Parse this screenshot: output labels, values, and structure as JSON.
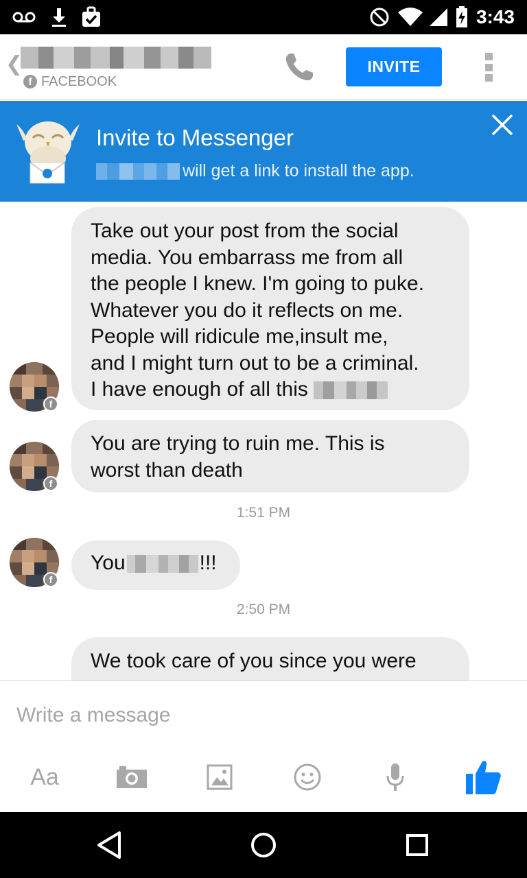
{
  "status_bar": {
    "time": "3:43",
    "icons": [
      "voicemail-icon",
      "download-icon",
      "bag-check-icon",
      "do-not-disturb-icon",
      "wifi-icon",
      "signal-icon",
      "battery-charging-icon"
    ]
  },
  "header": {
    "back_icon": "chevron-left-icon",
    "source_label": "FACEBOOK",
    "call_icon": "phone-icon",
    "invite_label": "INVITE",
    "more_icon": "more-vertical-icon"
  },
  "banner": {
    "title": "Invite to Messenger",
    "subtitle": "will get a link to install the app.",
    "close_icon": "close-icon",
    "bg_color": "#1b83d8"
  },
  "messages": [
    {
      "lines": [
        "Take out your post from the social",
        "media. You embarrass me from all",
        "the people I knew. I'm going to puke.",
        "Whatever you do it reflects on me.",
        "People will ridicule me,insult me,",
        "and I might turn out to be a criminal.",
        "I have enough of all this"
      ]
    },
    {
      "lines": [
        "You are trying to ruin me. This is",
        "worst than death"
      ]
    },
    {
      "prefix": "You",
      "suffix": "!!!"
    },
    {
      "lines": [
        "We took care of you since you were"
      ]
    }
  ],
  "timestamps": [
    "1:51 PM",
    "2:50 PM"
  ],
  "composer": {
    "placeholder": "Write a message",
    "text_tool_label": "Aa",
    "tools": [
      "text-format-button",
      "camera-icon",
      "gallery-icon",
      "emoji-icon",
      "microphone-icon",
      "like-icon"
    ],
    "accent": "#0a84ff"
  },
  "nav_bar": {
    "buttons": [
      "back-triangle-icon",
      "home-circle-icon",
      "recents-square-icon"
    ]
  }
}
